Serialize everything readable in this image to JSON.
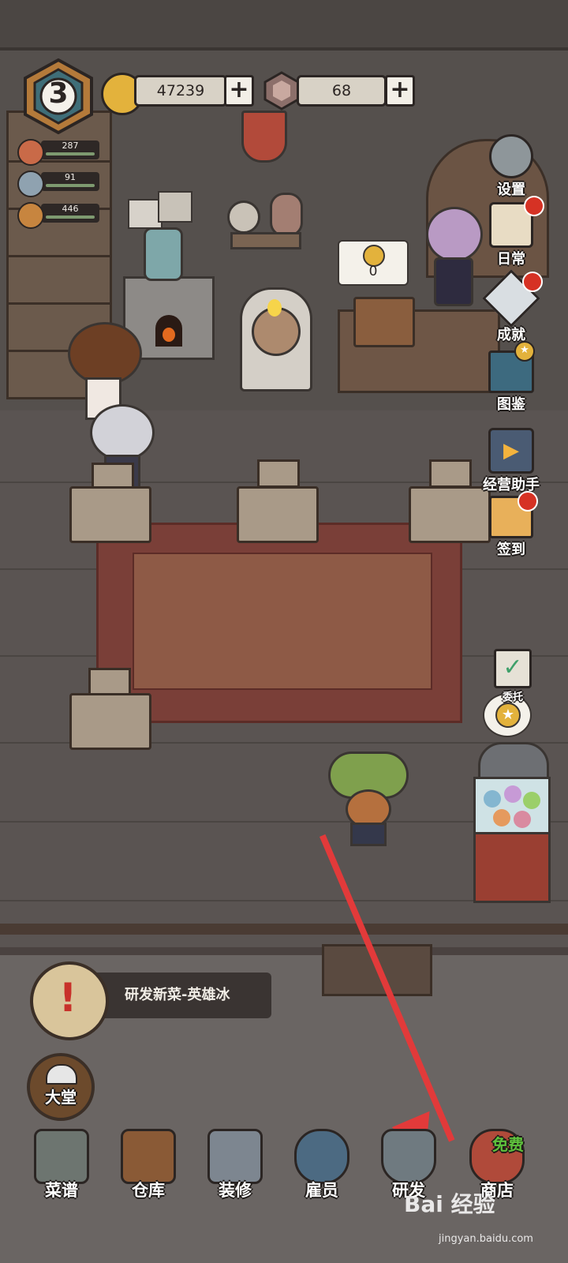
{
  "hud": {
    "level": "3",
    "coins": "47239",
    "gems": "68",
    "plus": "+",
    "stats": [
      {
        "icon": "food-icon",
        "value": "287"
      },
      {
        "icon": "cutlery-icon",
        "value": "91"
      },
      {
        "icon": "broom-icon",
        "value": "446"
      }
    ]
  },
  "counter": {
    "coin_value": "0"
  },
  "side_menu": [
    {
      "name": "settings",
      "label": "设置",
      "icon": "gear-icon",
      "dot": false
    },
    {
      "name": "daily",
      "label": "日常",
      "icon": "scroll-quill-icon",
      "dot": true
    },
    {
      "name": "achievement",
      "label": "成就",
      "icon": "crystal-icon",
      "dot": true
    },
    {
      "name": "encyclopedia",
      "label": "图鉴",
      "icon": "book-icon",
      "dot": false
    },
    {
      "name": "assistant",
      "label": "经营助手",
      "icon": "play-video-icon",
      "dot": false
    },
    {
      "name": "checkin",
      "label": "签到",
      "icon": "letter-icon",
      "dot": true
    }
  ],
  "commission": {
    "label": "委托"
  },
  "quest": {
    "text": "研发新菜-英雄冰"
  },
  "hall": {
    "label": "大堂"
  },
  "nav": [
    {
      "name": "recipes",
      "label": "菜谱",
      "icon": "recipe-hat-icon"
    },
    {
      "name": "warehouse",
      "label": "仓库",
      "icon": "cabinet-icon"
    },
    {
      "name": "decorate",
      "label": "装修",
      "icon": "hammer-icon"
    },
    {
      "name": "staff",
      "label": "雇员",
      "icon": "cap-character-icon"
    },
    {
      "name": "research",
      "label": "研发",
      "icon": "cauldron-icon"
    },
    {
      "name": "shop",
      "label": "商店",
      "icon": "shop-bag-icon",
      "badge": "免费"
    }
  ],
  "watermark": {
    "main": "Bai 经验",
    "sub": "jingyan.baidu.com"
  },
  "colors": {
    "arrow": "#e23a3a",
    "hud_bar": "#d8d2c6",
    "badge_free": "#5ec13c"
  }
}
